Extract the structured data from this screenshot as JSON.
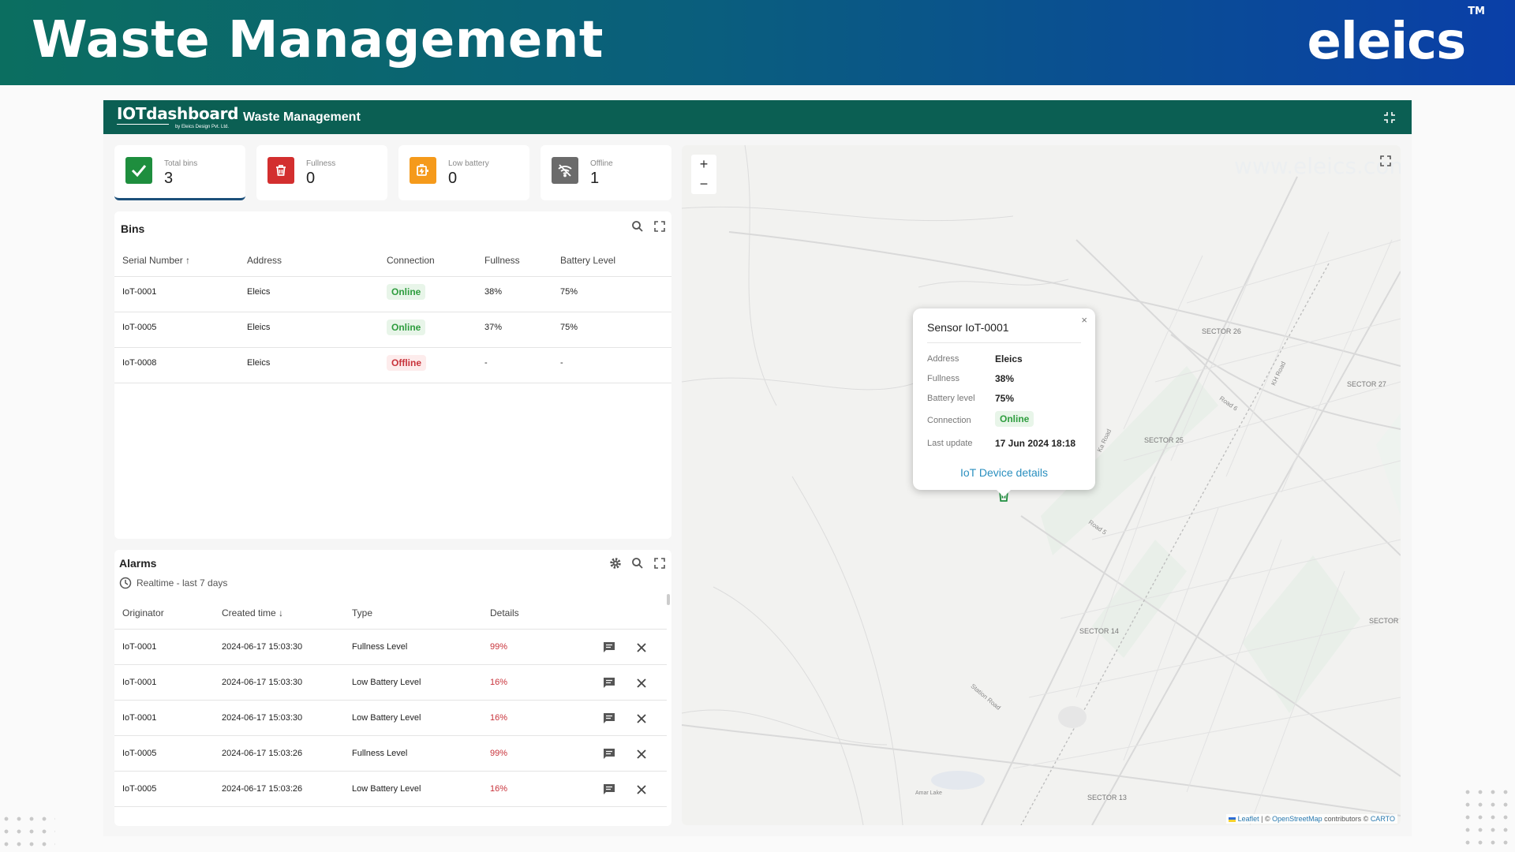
{
  "banner": {
    "title": "Waste Management",
    "brand": "eleics",
    "brand_tm": "TM"
  },
  "app": {
    "logo_main": "IOTdashboard",
    "logo_sub": "by Eleics Design Pvt. Ltd.",
    "title": "Waste Management"
  },
  "stats": [
    {
      "label": "Total bins",
      "value": "3",
      "icon": "check-icon",
      "color": "#1e8e3e"
    },
    {
      "label": "Fullness",
      "value": "0",
      "icon": "trash-icon",
      "color": "#d32f2f"
    },
    {
      "label": "Low battery",
      "value": "0",
      "icon": "battery-icon",
      "color": "#f59a1b"
    },
    {
      "label": "Offline",
      "value": "1",
      "icon": "wifi-off-icon",
      "color": "#6b6b6b"
    }
  ],
  "bins": {
    "title": "Bins",
    "columns": [
      "Serial Number",
      "Address",
      "Connection",
      "Fullness",
      "Battery Level"
    ],
    "rows": [
      {
        "serial": "IoT-0001",
        "address": "Eleics",
        "connection": "Online",
        "fullness": "38%",
        "battery": "75%"
      },
      {
        "serial": "IoT-0005",
        "address": "Eleics",
        "connection": "Online",
        "fullness": "37%",
        "battery": "75%"
      },
      {
        "serial": "IoT-0008",
        "address": "Eleics",
        "connection": "Offline",
        "fullness": "-",
        "battery": "-"
      }
    ]
  },
  "alarms": {
    "title": "Alarms",
    "realtime": "Realtime - last 7 days",
    "columns": [
      "Originator",
      "Created time",
      "Type",
      "Details"
    ],
    "rows": [
      {
        "originator": "IoT-0001",
        "time": "2024-06-17 15:03:30",
        "type": "Fullness Level",
        "details": "99%"
      },
      {
        "originator": "IoT-0001",
        "time": "2024-06-17 15:03:30",
        "type": "Low Battery Level",
        "details": "16%"
      },
      {
        "originator": "IoT-0001",
        "time": "2024-06-17 15:03:30",
        "type": "Low Battery Level",
        "details": "16%"
      },
      {
        "originator": "IoT-0005",
        "time": "2024-06-17 15:03:26",
        "type": "Fullness Level",
        "details": "99%"
      },
      {
        "originator": "IoT-0005",
        "time": "2024-06-17 15:03:26",
        "type": "Low Battery Level",
        "details": "16%"
      }
    ]
  },
  "map": {
    "zoom_in": "+",
    "zoom_out": "−",
    "labels": [
      "SECTOR 26",
      "SECTOR 27",
      "SECTOR 25",
      "SECTOR 14",
      "SECTOR 13",
      "SECTOR",
      "Ka Road",
      "Road 6",
      "Road 5",
      "KH Road",
      "Station Road",
      "Amar Lake"
    ],
    "popup": {
      "title": "Sensor IoT-0001",
      "close": "×",
      "fields": [
        {
          "key": "Address",
          "value": "Eleics"
        },
        {
          "key": "Fullness",
          "value": "38%"
        },
        {
          "key": "Battery level",
          "value": "75%"
        },
        {
          "key": "Connection",
          "value": "Online"
        },
        {
          "key": "Last update",
          "value": "17 Jun 2024 18:18"
        }
      ],
      "link": "IoT Device details"
    },
    "attribution": {
      "leaflet": "Leaflet",
      "sep1": " | © ",
      "osm": "OpenStreetMap",
      "mid": " contributors © ",
      "carto": "CARTO"
    }
  },
  "watermark": "www.eleics.com"
}
